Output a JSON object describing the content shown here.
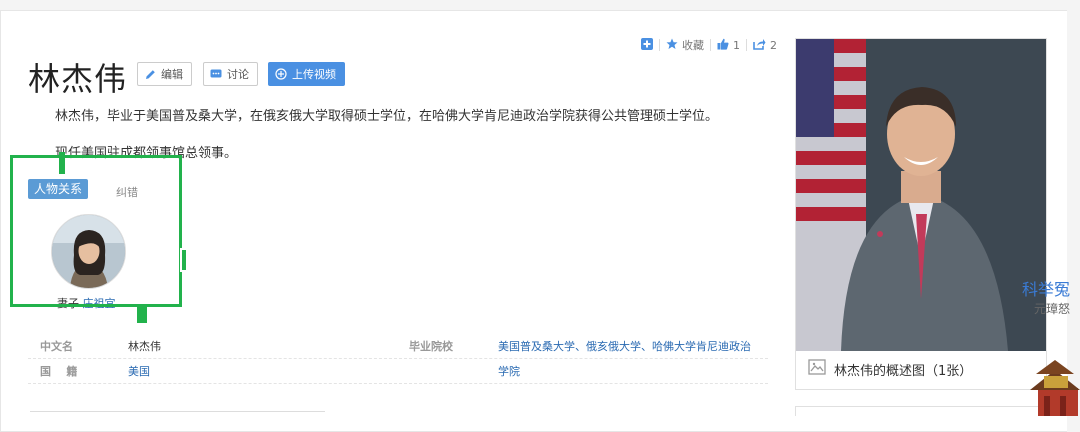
{
  "person": {
    "name": "林杰伟",
    "summary": "林杰伟，毕业于美国普及桑大学，在俄亥俄大学取得硕士学位，在哈佛大学肯尼迪政治学院获得公共管理硕士学位。",
    "summary2": "现任美国驻成都领事馆总领事。"
  },
  "title_buttons": {
    "edit": "编辑",
    "discuss": "讨论",
    "upload_video": "上传视频"
  },
  "toolbar": {
    "favorite": "收藏",
    "like_count": "1",
    "share_count": "2"
  },
  "relations": {
    "tab_label": "人物关系",
    "correct_label": "纠错",
    "relation_type": "妻子",
    "relation_name": "庄祖宜"
  },
  "info_table": {
    "rows": [
      {
        "k1": "中文名",
        "v1": "林杰伟",
        "k2": "毕业院校",
        "v2": "美国普及桑大学、俄亥俄大学、哈佛大学肯尼迪政治"
      },
      {
        "k1": "国    籍",
        "v1": "美国",
        "k2": "",
        "v2": "学院"
      }
    ]
  },
  "photo": {
    "caption": "林杰伟的概述图（1张）"
  },
  "side": {
    "text1": "科举冤",
    "text2": "元璋怒"
  },
  "colors": {
    "accent": "#4a90e2",
    "highlight_box": "#22b24c",
    "link": "#2a6ab2"
  }
}
